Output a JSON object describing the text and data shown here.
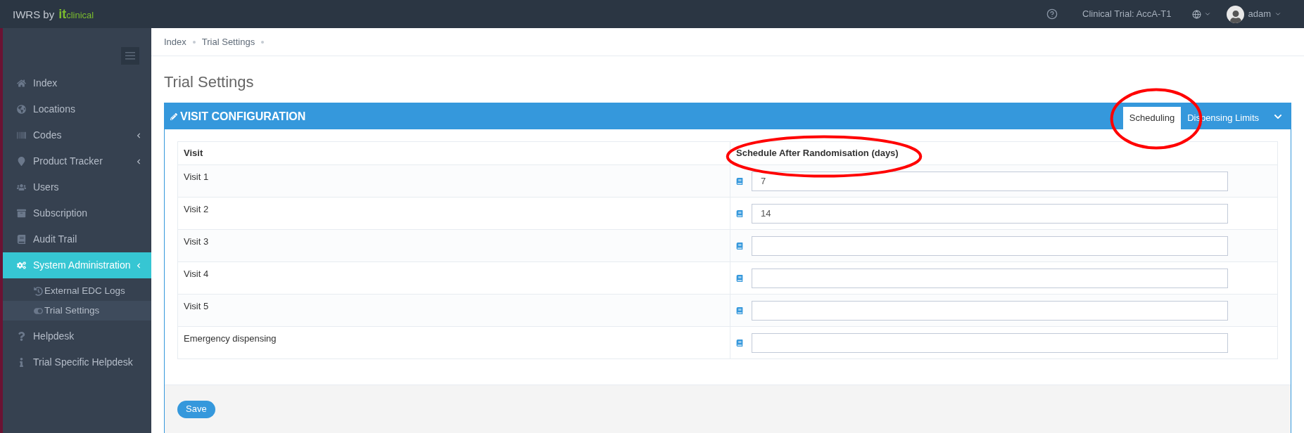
{
  "topbar": {
    "brand": "IWRS by",
    "logo_it": "it",
    "logo_clinical": "clinical",
    "trial": "Clinical Trial: AccA-T1",
    "user": "adam"
  },
  "sidebar": {
    "items": [
      {
        "label": "Index",
        "kind": "home",
        "submenu": false,
        "selected": false
      },
      {
        "label": "Locations",
        "kind": "globe",
        "submenu": false,
        "selected": false
      },
      {
        "label": "Codes",
        "kind": "barcode",
        "submenu": true,
        "selected": false
      },
      {
        "label": "Product Tracker",
        "kind": "marker",
        "submenu": true,
        "selected": false
      },
      {
        "label": "Users",
        "kind": "users",
        "submenu": false,
        "selected": false
      },
      {
        "label": "Subscription",
        "kind": "archive",
        "submenu": false,
        "selected": false
      },
      {
        "label": "Audit Trail",
        "kind": "book",
        "submenu": false,
        "selected": false
      },
      {
        "label": "System Administration",
        "kind": "cogs",
        "submenu": true,
        "selected": true,
        "children": [
          {
            "label": "External EDC Logs",
            "kind": "history",
            "selected": false
          },
          {
            "label": "Trial Settings",
            "kind": "toggle",
            "selected": true
          }
        ]
      },
      {
        "label": "Helpdesk",
        "kind": "question",
        "submenu": false,
        "selected": false
      },
      {
        "label": "Trial Specific Helpdesk",
        "kind": "info",
        "submenu": false,
        "selected": false
      }
    ]
  },
  "breadcrumb": [
    "Index",
    "Trial Settings"
  ],
  "page_title": "Trial Settings",
  "panel": {
    "title": "VISIT CONFIGURATION",
    "tabs": [
      {
        "label": "Scheduling",
        "selected": true
      },
      {
        "label": "Dispensing Limits",
        "selected": false
      }
    ],
    "table": {
      "columns": [
        "Visit",
        "Schedule After Randomisation (days)"
      ],
      "rows": [
        {
          "visit": "Visit 1",
          "value": "7"
        },
        {
          "visit": "Visit 2",
          "value": "14"
        },
        {
          "visit": "Visit 3"
        },
        {
          "visit": "Visit 4"
        },
        {
          "visit": "Visit 5"
        },
        {
          "visit": "Emergency dispensing"
        }
      ]
    },
    "save": "Save"
  },
  "annotations": [
    {
      "kind": "ellipse"
    },
    {
      "kind": "ellipse"
    }
  ]
}
